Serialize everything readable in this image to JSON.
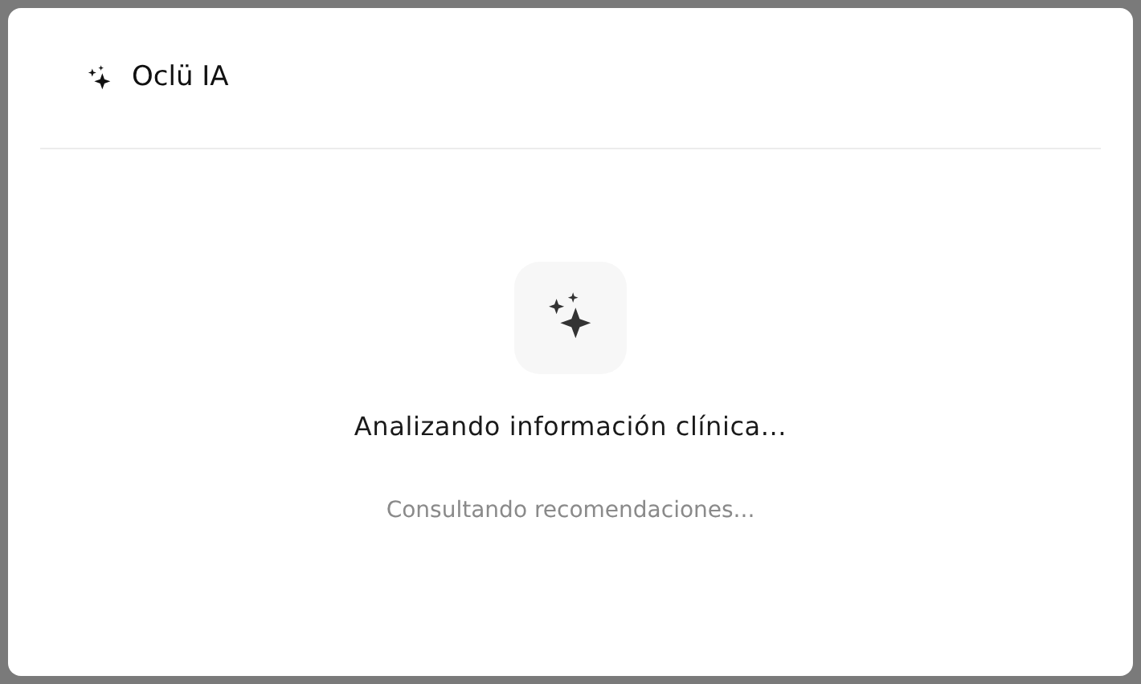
{
  "dialog": {
    "title": "Oclü IA",
    "status": {
      "message": "Analizando información clínica...",
      "detail": "Consultando recomendaciones..."
    }
  }
}
